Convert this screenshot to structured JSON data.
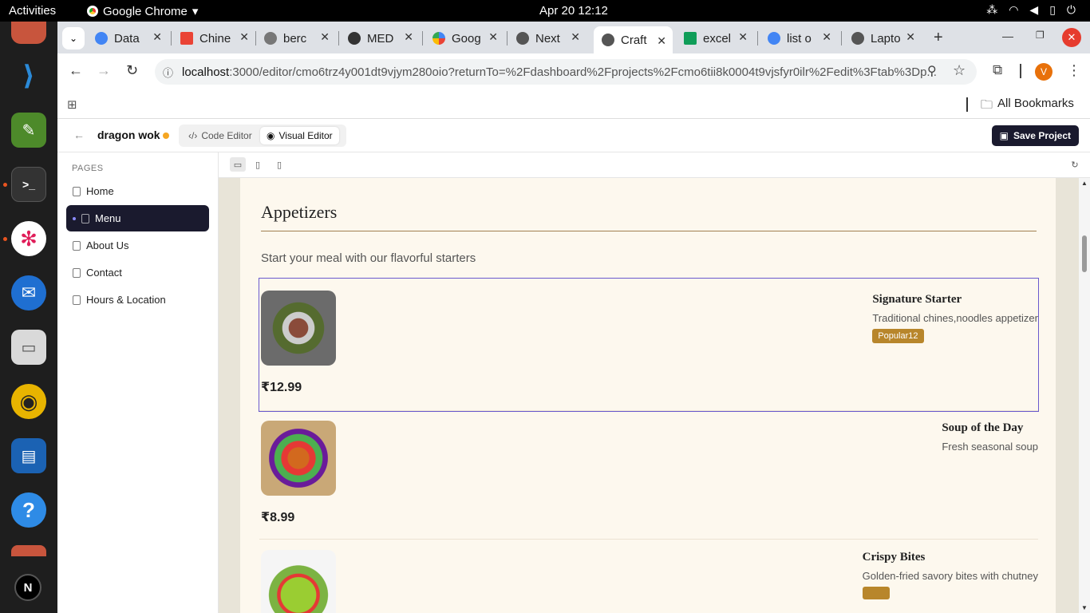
{
  "system": {
    "activities": "Activities",
    "app_name": "Google Chrome",
    "clock": "Apr 20  12:12"
  },
  "browser": {
    "tabs": [
      {
        "label": "Data",
        "favicon_color": "#4285f4"
      },
      {
        "label": "Chine",
        "favicon_color": "#ea4335"
      },
      {
        "label": "berc",
        "favicon_color": "#777777"
      },
      {
        "label": "MED",
        "favicon_color": "#333333"
      },
      {
        "label": "Goog",
        "favicon_color": "#fbbc05"
      },
      {
        "label": "Next",
        "favicon_color": "#555555"
      },
      {
        "label": "Craft",
        "favicon_color": "#555555"
      },
      {
        "label": "excel",
        "favicon_color": "#0f9d58"
      },
      {
        "label": "list o",
        "favicon_color": "#4285f4"
      },
      {
        "label": "Lapto",
        "favicon_color": "#555555"
      }
    ],
    "url_host": "localhost",
    "url_rest": ":3000/editor/cmo6trz4y001dt9vjym280oio?returnTo=%2Fdashboard%2Fprojects%2Fcmo6tii8k0004t9vjsfyr0ilr%2Fedit%3Ftab%3Dp...",
    "profile_initial": "V",
    "bookmarks_label": "All Bookmarks"
  },
  "editor": {
    "project_name": "dragon wok",
    "code_editor_label": "Code Editor",
    "visual_editor_label": "Visual Editor",
    "save_label": "Save Project",
    "pages_heading": "PAGES",
    "pages": [
      "Home",
      "Menu",
      "About Us",
      "Contact",
      "Hours & Location"
    ]
  },
  "site": {
    "section_title": "Appetizers",
    "section_desc": "Start your meal with our flavorful starters",
    "items": [
      {
        "name": "Signature Starter",
        "desc": "Traditional chines,noodles appetizer",
        "price": "₹12.99",
        "badge": "Popular12"
      },
      {
        "name": "Soup of the Day",
        "desc": "Fresh seasonal soup",
        "price": "₹8.99",
        "badge": ""
      },
      {
        "name": "Crispy Bites",
        "desc": "Golden-fried savory bites with chutney",
        "price": "",
        "badge": ""
      }
    ]
  },
  "accent_color": "#1a1a2e",
  "next_badge": "N"
}
